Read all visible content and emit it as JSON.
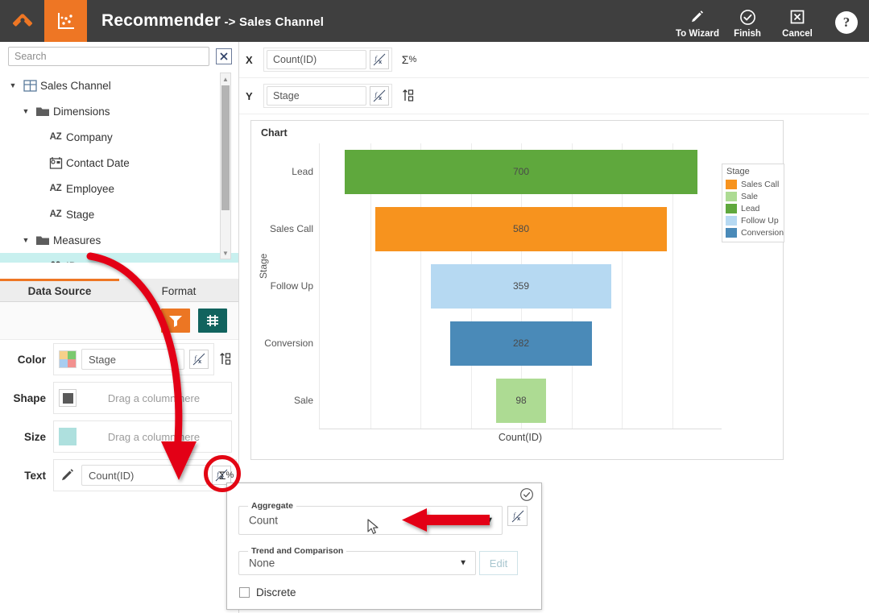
{
  "header": {
    "title": "Recommender",
    "subtitle": " -> Sales Channel",
    "logo_icon": "tools-logo-icon",
    "chart_tab_icon": "scatter-chart-icon",
    "actions": [
      {
        "label": "To Wizard",
        "icon": "pencil-icon"
      },
      {
        "label": "Finish",
        "icon": "check-circle-icon"
      },
      {
        "label": "Cancel",
        "icon": "x-box-icon"
      }
    ],
    "help_label": "?"
  },
  "sidebar": {
    "search": {
      "placeholder": "Search",
      "value": ""
    },
    "clear_icon": "close-x-icon",
    "tree": [
      {
        "label": "Sales Channel",
        "icon": "table-icon",
        "indent": 0,
        "caret": "▼",
        "selected": false
      },
      {
        "label": "Dimensions",
        "icon": "folder-icon",
        "indent": 1,
        "caret": "▼",
        "selected": false
      },
      {
        "label": "Company",
        "icon": "az-icon",
        "indent": 2,
        "caret": "",
        "selected": false
      },
      {
        "label": "Contact Date",
        "icon": "calendar-icon",
        "indent": 2,
        "caret": "",
        "selected": false
      },
      {
        "label": "Employee",
        "icon": "az-icon",
        "indent": 2,
        "caret": "",
        "selected": false
      },
      {
        "label": "Stage",
        "icon": "az-icon",
        "indent": 2,
        "caret": "",
        "selected": false
      },
      {
        "label": "Measures",
        "icon": "folder-icon",
        "indent": 1,
        "caret": "▼",
        "selected": false
      },
      {
        "label": "ID",
        "icon": "09-icon",
        "indent": 2,
        "caret": "",
        "selected": true
      }
    ],
    "tabs": [
      {
        "label": "Data Source",
        "active": true
      },
      {
        "label": "Format",
        "active": false
      }
    ],
    "toolbar": [
      {
        "name": "filter-button",
        "icon": "funnel-icon",
        "color": "#ec7623"
      },
      {
        "name": "sort-button",
        "icon": "sort-icon",
        "color": "#11635e"
      }
    ],
    "shelves": [
      {
        "label": "Color",
        "value": "Stage",
        "placeholder": "",
        "swatch": "color-palette-swatch",
        "has_fx": true,
        "has_sort": true
      },
      {
        "label": "Shape",
        "value": "",
        "placeholder": "Drag a column here",
        "swatch": "shape-swatch",
        "has_fx": false,
        "has_sort": false
      },
      {
        "label": "Size",
        "value": "",
        "placeholder": "Drag a column here",
        "swatch": "size-swatch",
        "has_fx": false,
        "has_sort": false
      },
      {
        "label": "Text",
        "value": "Count(ID)",
        "placeholder": "",
        "swatch": "pencil-swatch",
        "has_fx": true,
        "has_sigma": true
      }
    ]
  },
  "main": {
    "axes": [
      {
        "label": "X",
        "value": "Count(ID)",
        "fx_icon": "fx-icon",
        "extra_icon": "sigma-percent-icon"
      },
      {
        "label": "Y",
        "value": "Stage",
        "fx_icon": "fx-icon",
        "extra_icon": "sort-numeric-icon"
      }
    ],
    "chart_title": "Chart"
  },
  "chart_data": {
    "type": "bar",
    "orientation": "horizontal-funnel",
    "title": "Chart",
    "xlabel": "Count(ID)",
    "ylabel": "Stage",
    "categories": [
      "Lead",
      "Sales Call",
      "Follow Up",
      "Conversion",
      "Sale"
    ],
    "values": [
      700,
      580,
      359,
      282,
      98
    ],
    "labels": [
      "700",
      "580",
      "359",
      "282",
      "98"
    ],
    "colors": [
      "#5fa83d",
      "#f7931e",
      "#b6d9f2",
      "#4a8ab8",
      "#addb93"
    ],
    "xlim": [
      0,
      800
    ],
    "grid": true,
    "centered": true,
    "legend": {
      "title": "Stage",
      "position": "right",
      "entries": [
        {
          "label": "Sales Call",
          "color": "#f7931e"
        },
        {
          "label": "Sale",
          "color": "#addb93"
        },
        {
          "label": "Lead",
          "color": "#5fa83d"
        },
        {
          "label": "Follow Up",
          "color": "#b6d9f2"
        },
        {
          "label": "Conversion",
          "color": "#4a8ab8"
        }
      ]
    }
  },
  "popup": {
    "ok_icon": "check-circle-icon",
    "aggregate": {
      "legend": "Aggregate",
      "value": "Count",
      "fx_icon": "fx-icon"
    },
    "trend": {
      "legend": "Trend and Comparison",
      "value": "None",
      "edit_label": "Edit"
    },
    "discrete": {
      "label": "Discrete",
      "checked": false
    }
  },
  "annotations": {
    "accent_orange": "#ee7624",
    "annotation_red": "#e30613",
    "curved_arrow": "id-to-text-shelf",
    "straight_arrow": "points-to-aggregate-dropdown",
    "highlight_circle": "sigma-percent-button"
  }
}
